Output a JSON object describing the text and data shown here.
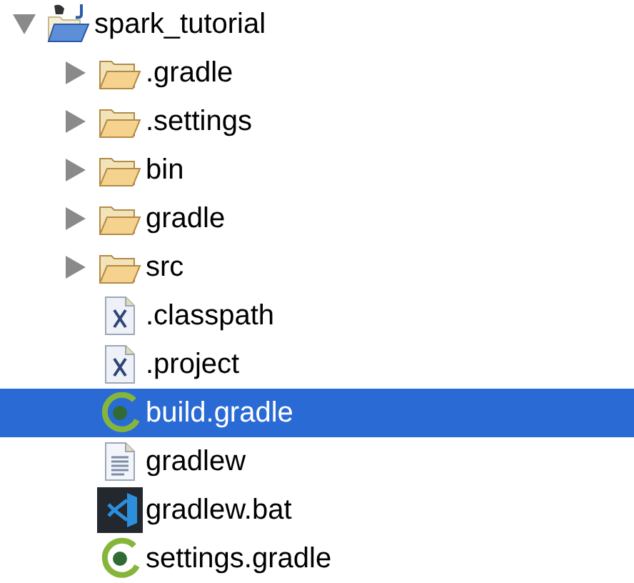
{
  "tree": {
    "label": "spark_tutorial",
    "kind": "project",
    "expanded": true,
    "selected": false,
    "children": [
      {
        "label": ".gradle",
        "kind": "folder",
        "expanded": false,
        "selected": false
      },
      {
        "label": ".settings",
        "kind": "folder",
        "expanded": false,
        "selected": false
      },
      {
        "label": "bin",
        "kind": "folder",
        "expanded": false,
        "selected": false
      },
      {
        "label": "gradle",
        "kind": "folder",
        "expanded": false,
        "selected": false
      },
      {
        "label": "src",
        "kind": "folder",
        "expanded": false,
        "selected": false
      },
      {
        "label": ".classpath",
        "kind": "xml",
        "selected": false
      },
      {
        "label": ".project",
        "kind": "xml",
        "selected": false
      },
      {
        "label": "build.gradle",
        "kind": "gradle",
        "selected": true
      },
      {
        "label": "gradlew",
        "kind": "text",
        "selected": false
      },
      {
        "label": "gradlew.bat",
        "kind": "script",
        "selected": false
      },
      {
        "label": "settings.gradle",
        "kind": "gradle",
        "selected": false
      }
    ]
  }
}
